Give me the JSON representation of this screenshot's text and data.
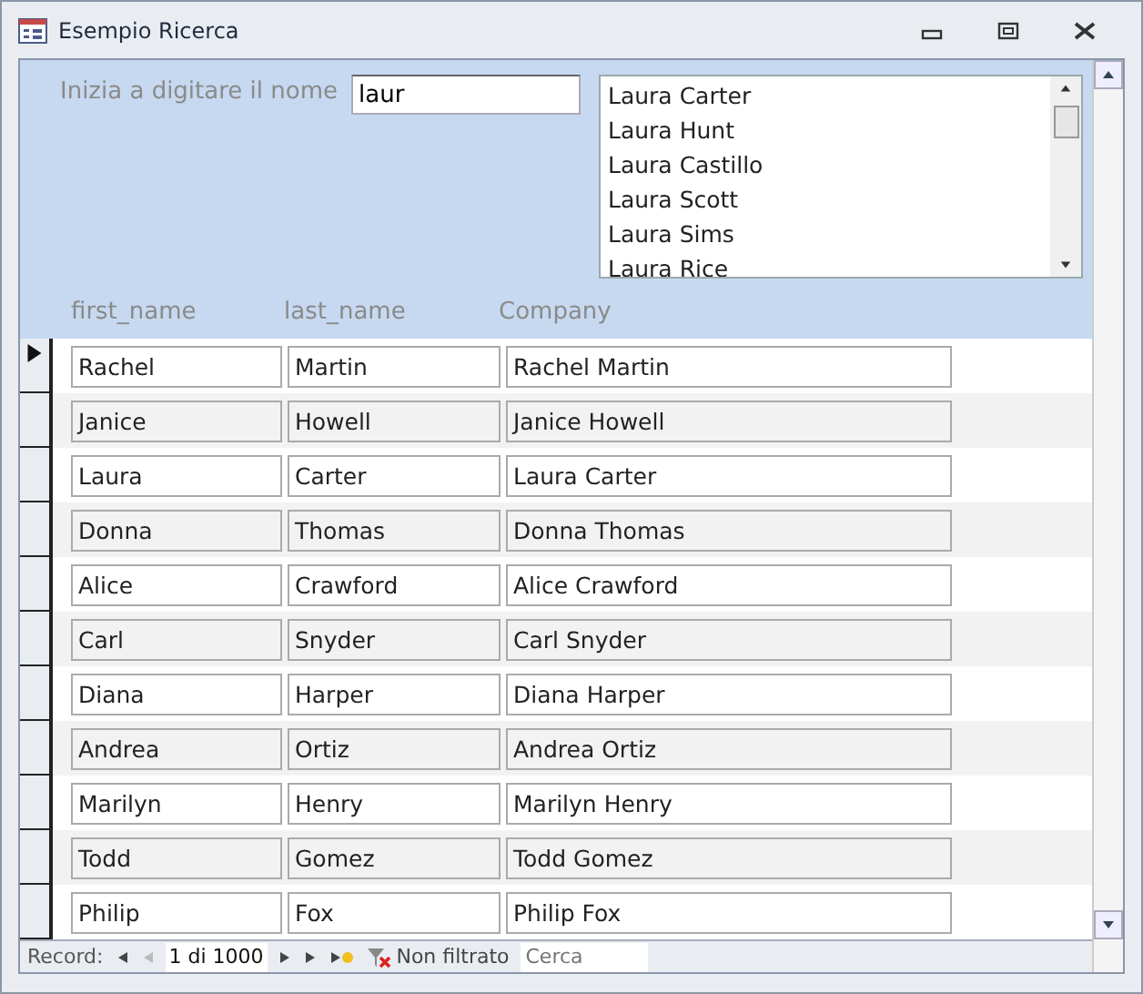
{
  "window": {
    "title": "Esempio Ricerca"
  },
  "search": {
    "label": "Inizia a digitare il nome",
    "value": "laur"
  },
  "results": [
    "Laura Carter",
    "Laura Hunt",
    "Laura Castillo",
    "Laura Scott",
    "Laura Sims",
    "Laura Rice"
  ],
  "columns": [
    "first_name",
    "last_name",
    "Company"
  ],
  "rows": [
    {
      "cells": [
        "Rachel",
        "Martin",
        "Rachel Martin"
      ],
      "selected": true
    },
    {
      "cells": [
        "Janice",
        "Howell",
        "Janice Howell"
      ],
      "selected": false
    },
    {
      "cells": [
        "Laura",
        "Carter",
        "Laura Carter"
      ],
      "selected": false
    },
    {
      "cells": [
        "Donna",
        "Thomas",
        "Donna Thomas"
      ],
      "selected": false
    },
    {
      "cells": [
        "Alice",
        "Crawford",
        "Alice Crawford"
      ],
      "selected": false
    },
    {
      "cells": [
        "Carl",
        "Snyder",
        "Carl Snyder"
      ],
      "selected": false
    },
    {
      "cells": [
        "Diana",
        "Harper",
        "Diana Harper"
      ],
      "selected": false
    },
    {
      "cells": [
        "Andrea",
        "Ortiz",
        "Andrea Ortiz"
      ],
      "selected": false
    },
    {
      "cells": [
        "Marilyn",
        "Henry",
        "Marilyn Henry"
      ],
      "selected": false
    },
    {
      "cells": [
        "Todd",
        "Gomez",
        "Todd Gomez"
      ],
      "selected": false
    },
    {
      "cells": [
        "Philip",
        "Fox",
        "Philip Fox"
      ],
      "selected": false
    }
  ],
  "navigation": {
    "label": "Record:",
    "position": "1 di 1000",
    "filter": "Non filtrato",
    "search_placeholder": "Cerca"
  }
}
